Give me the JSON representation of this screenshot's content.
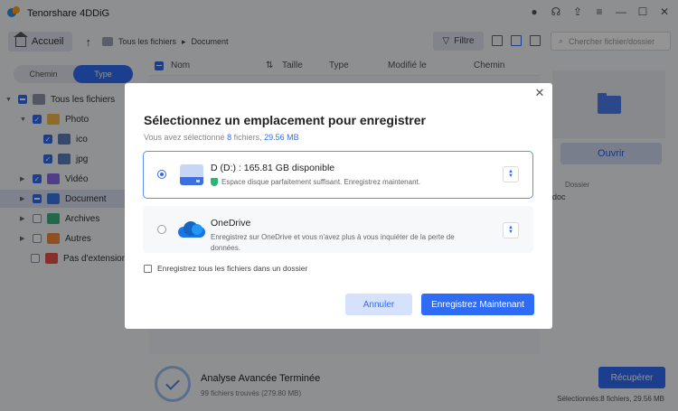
{
  "app": {
    "title": "Tenorshare 4DDiG"
  },
  "toolbar": {
    "home_label": "Accueil",
    "breadcrumb": [
      "Tous les fichiers",
      "Document"
    ],
    "filter_label": "Filtre",
    "search_placeholder": "Chercher fichier/dossier"
  },
  "sidebar": {
    "tabs": [
      "Chemin",
      "Type"
    ],
    "active_tab": "Type",
    "tree": [
      {
        "label": "Tous les fichiers",
        "state": "partial",
        "expanded": true
      },
      {
        "label": "Photo",
        "state": "checked",
        "expanded": true
      },
      {
        "label": "ico",
        "state": "checked"
      },
      {
        "label": "jpg",
        "state": "checked"
      },
      {
        "label": "Vidéo",
        "state": "checked"
      },
      {
        "label": "Document",
        "state": "partial",
        "selected": true
      },
      {
        "label": "Archives",
        "state": "unchecked"
      },
      {
        "label": "Autres",
        "state": "unchecked"
      },
      {
        "label": "Pas d'extension",
        "state": "unchecked"
      }
    ]
  },
  "list": {
    "columns": [
      "Nom",
      "Taille",
      "Type",
      "Modifié le",
      "Chemin"
    ]
  },
  "preview": {
    "open_label": "Ouvrir",
    "meta_label": "Dossier",
    "meta_value": "doc"
  },
  "status": {
    "title": "Analyse Avancée Terminée",
    "subtitle": "99 fichiers trouvés (279.80 MB)",
    "recover_label": "Récupérer",
    "selection": "Sélectionnés:8 fichiers, 29.56 MB"
  },
  "dialog": {
    "title": "Sélectionnez un emplacement pour enregistrer",
    "subtitle_prefix": "Vous avez sélectionné",
    "count": "8",
    "subtitle_mid": " fichiers,",
    "size": "29.56 MB",
    "options": [
      {
        "title": "D (D:) : 165.81 GB disponible",
        "note": "Espace disque parfaitement suffisant. Enregistrez maintenant.",
        "selected": true
      },
      {
        "title": "OneDrive",
        "note": "Enregistrez sur OneDrive et vous n'avez plus à vous inquiéter de la perte de données.",
        "selected": false
      }
    ],
    "save_all_label": "Enregistrez tous les fichiers dans un dossier",
    "save_all_checked": false,
    "cancel_label": "Annuler",
    "save_label": "Enregistrez Maintenant"
  },
  "colors": {
    "accent": "#2f6cf6",
    "success": "#2bb673"
  }
}
